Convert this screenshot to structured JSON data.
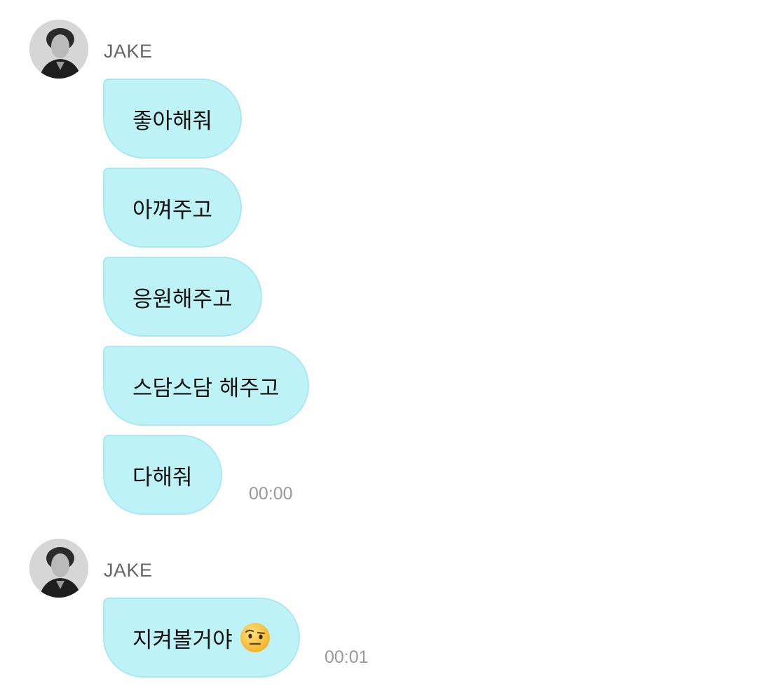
{
  "groups": [
    {
      "sender": "JAKE",
      "avatar_icon": "profile-photo-avatar",
      "messages": [
        {
          "text": "좋아해줘"
        },
        {
          "text": "아껴주고"
        },
        {
          "text": "응원해주고"
        },
        {
          "text": "스담스담 해주고"
        },
        {
          "text": "다해줘"
        }
      ],
      "timestamp": "00:00"
    },
    {
      "sender": "JAKE",
      "avatar_icon": "profile-photo-avatar",
      "messages": [
        {
          "text": "지켜볼거야",
          "emoji": "face-with-raised-eyebrow-emoji"
        }
      ],
      "timestamp": "00:01"
    }
  ],
  "colors": {
    "bubble": "#bdf3f6",
    "bubble_border": "#a9e9ef",
    "name": "#666666",
    "timestamp": "#999999"
  }
}
